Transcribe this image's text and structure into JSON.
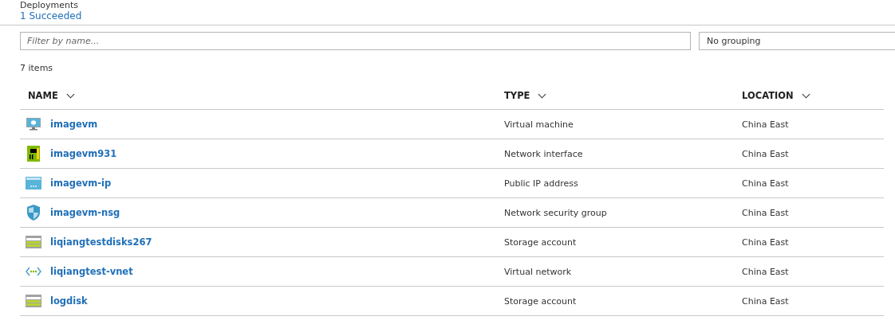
{
  "deployments": {
    "heading": "Deployments",
    "link": "1 Succeeded"
  },
  "filter": {
    "placeholder": "Filter by name..."
  },
  "grouping": {
    "value": "No grouping"
  },
  "item_count": "7 items",
  "table": {
    "columns": [
      "NAME",
      "TYPE",
      "LOCATION"
    ],
    "rows": [
      {
        "kind": "vm",
        "name": "imagevm",
        "type": "Virtual machine",
        "location": "China East"
      },
      {
        "kind": "nic",
        "name": "imagevm931",
        "type": "Network interface",
        "location": "China East"
      },
      {
        "kind": "ip",
        "name": "imagevm-ip",
        "type": "Public IP address",
        "location": "China East"
      },
      {
        "kind": "nsg",
        "name": "imagevm-nsg",
        "type": "Network security group",
        "location": "China East"
      },
      {
        "kind": "storage",
        "name": "liqiangtestdisks267",
        "type": "Storage account",
        "location": "China East"
      },
      {
        "kind": "vnet",
        "name": "liqiangtest-vnet",
        "type": "Virtual network",
        "location": "China East"
      },
      {
        "kind": "storage",
        "name": "logdisk",
        "type": "Storage account",
        "location": "China East"
      }
    ]
  }
}
